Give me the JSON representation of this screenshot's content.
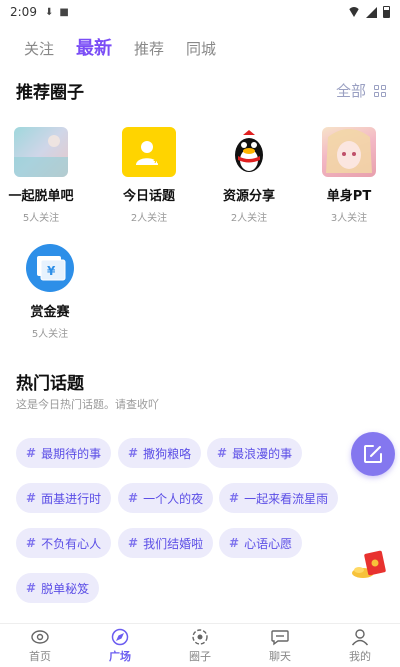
{
  "status_bar": {
    "time": "2:09"
  },
  "top_tabs": [
    {
      "label": "关注"
    },
    {
      "label": "最新"
    },
    {
      "label": "推荐"
    },
    {
      "label": "同城"
    }
  ],
  "active_tab": "最新",
  "recommended": {
    "title": "推荐圈子",
    "see_all": "全部",
    "items": [
      {
        "name": "一起脱单吧",
        "count": "5人关注"
      },
      {
        "name": "今日话题",
        "count": "2人关注"
      },
      {
        "name": "资源分享",
        "count": "2人关注"
      },
      {
        "name": "单身PT",
        "count": "3人关注"
      },
      {
        "name": "赏金赛",
        "count": "5人关注"
      }
    ]
  },
  "hot_topics": {
    "title": "热门话题",
    "subtitle": "这是今日热门话题。请查收吖",
    "tags": [
      {
        "label": "最期待的事"
      },
      {
        "label": "撒狗粮咯"
      },
      {
        "label": "最浪漫的事"
      },
      {
        "label": "面基进行时"
      },
      {
        "label": "一个人的夜"
      },
      {
        "label": "一起来看流星雨"
      },
      {
        "label": "不负有心人"
      },
      {
        "label": "我们结婚啦"
      },
      {
        "label": "心语心愿"
      },
      {
        "label": "脱单秘笈"
      }
    ]
  },
  "bottom_nav": [
    {
      "label": "首页",
      "icon": "home-icon"
    },
    {
      "label": "广场",
      "icon": "compass-icon"
    },
    {
      "label": "圈子",
      "icon": "circle-icon"
    },
    {
      "label": "聊天",
      "icon": "chat-icon"
    },
    {
      "label": "我的",
      "icon": "user-icon"
    }
  ],
  "colors": {
    "accent": "#7b4ef6",
    "chip_bg": "#ecebfb",
    "chip_text": "#5b4ee6",
    "fab": "#8477ef"
  }
}
